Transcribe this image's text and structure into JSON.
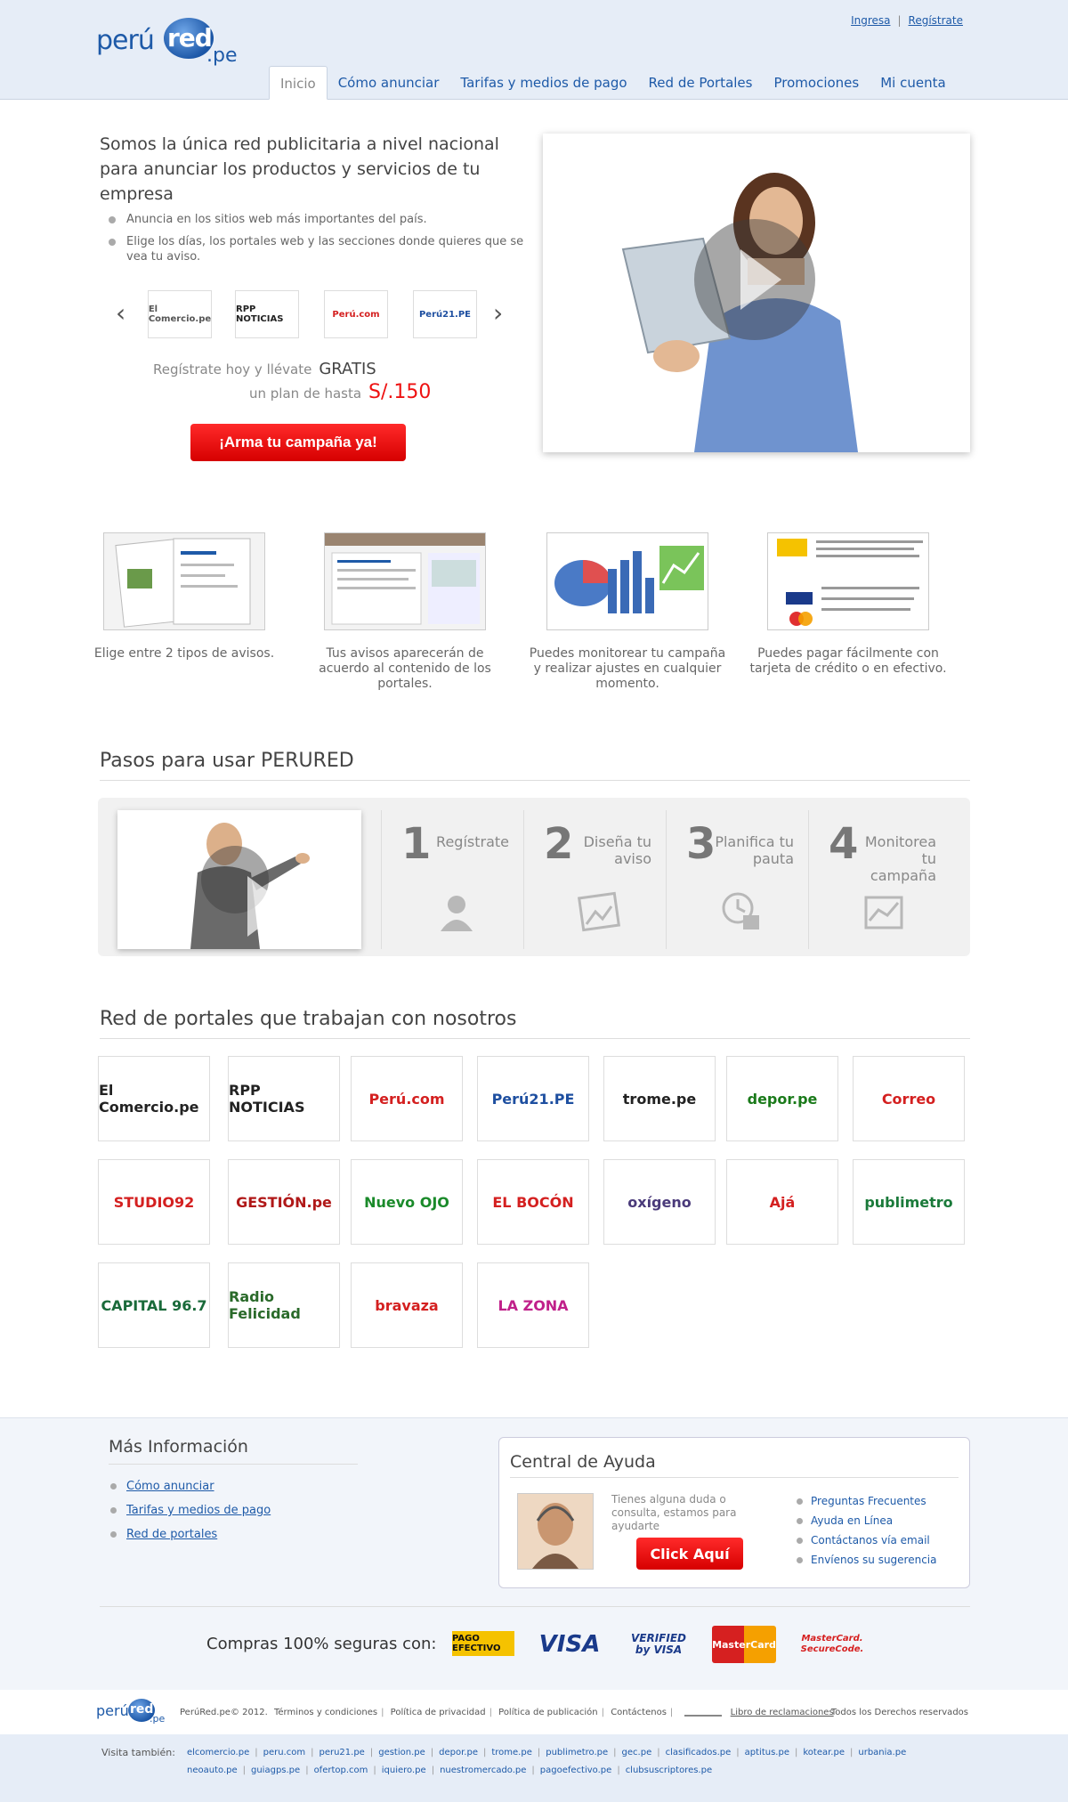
{
  "header": {
    "logo": {
      "part1": "perú",
      "part2": "red",
      "part3": ".pe"
    },
    "top_links": {
      "login": "Ingresa",
      "separator": "|",
      "register": "Regístrate"
    },
    "nav": [
      {
        "label": "Inicio",
        "active": true
      },
      {
        "label": "Cómo anunciar"
      },
      {
        "label": "Tarifas y medios de pago"
      },
      {
        "label": "Red de Portales"
      },
      {
        "label": "Promociones"
      },
      {
        "label": "Mi cuenta"
      }
    ]
  },
  "hero": {
    "title": "Somos la única red publicitaria a nivel nacional para anunciar los productos y servicios de tu empresa",
    "bullets": [
      "Anuncia en los sitios web más importantes del país.",
      "Elige los días, los portales web y las secciones donde quieres que se vea tu aviso."
    ],
    "carousel": {
      "prev": "‹",
      "next": "›",
      "logos": [
        "El Comercio.pe",
        "RPP NOTICIAS",
        "Perú.com",
        "Perú21.PE"
      ]
    },
    "promo_line1": "Regístrate hoy y llévate",
    "promo_highlight1": "GRATIS",
    "promo_line2": "un plan de hasta",
    "promo_highlight2": "S/.150",
    "cta": "¡Arma tu campaña ya!"
  },
  "features": [
    {
      "caption": "Elige entre 2 tipos de avisos."
    },
    {
      "caption": "Tus avisos aparecerán de acuerdo al contenido de los portales."
    },
    {
      "caption": "Puedes monitorear tu campaña y realizar ajustes en cualquier momento."
    },
    {
      "caption": "Puedes pagar fácilmente con tarjeta de crédito o en efectivo."
    }
  ],
  "steps_section": {
    "title": "Pasos para usar PERURED",
    "steps": [
      {
        "number": "1",
        "label": "Regístrate",
        "icon": "user-icon"
      },
      {
        "number": "2",
        "label": "Diseña tu aviso",
        "icon": "image-icon"
      },
      {
        "number": "3",
        "label": "Planifica tu pauta",
        "icon": "calendar-clock-icon"
      },
      {
        "number": "4",
        "label": "Monitorea tu campaña",
        "icon": "chart-icon"
      }
    ]
  },
  "portals_section": {
    "title": "Red de portales que trabajan con nosotros",
    "portals": [
      {
        "name": "El Comercio.pe",
        "color": "#222222"
      },
      {
        "name": "RPP NOTICIAS",
        "color": "#222222"
      },
      {
        "name": "Perú.com",
        "color": "#d42020"
      },
      {
        "name": "Perú21.PE",
        "color": "#1e4fa0"
      },
      {
        "name": "trome.pe",
        "color": "#222222"
      },
      {
        "name": "depor.pe",
        "color": "#1a7a1a"
      },
      {
        "name": "Correo",
        "color": "#d42020"
      },
      {
        "name": "STUDIO92",
        "color": "#d42020"
      },
      {
        "name": "GESTIÓN.pe",
        "color": "#b01818"
      },
      {
        "name": "Nuevo OJO",
        "color": "#1a8a2a"
      },
      {
        "name": "EL BOCÓN",
        "color": "#d42020"
      },
      {
        "name": "oxígeno",
        "color": "#4a3a7a"
      },
      {
        "name": "Ajá",
        "color": "#d42020"
      },
      {
        "name": "publimetro",
        "color": "#1a7a3a"
      },
      {
        "name": "CAPITAL 96.7",
        "color": "#1a6a3a"
      },
      {
        "name": "Radio Felicidad",
        "color": "#2a6a2a"
      },
      {
        "name": "bravaza",
        "color": "#d42020"
      },
      {
        "name": "LA ZONA",
        "color": "#c0208a"
      }
    ]
  },
  "more_info": {
    "title": "Más Información",
    "links": [
      "Cómo anunciar",
      "Tarifas y medios de pago",
      "Red de portales"
    ]
  },
  "help_center": {
    "title": "Central de Ayuda",
    "text": "Tienes alguna duda o consulta, estamos para ayudarte",
    "button": "Click Aquí",
    "links": [
      "Preguntas Frecuentes",
      "Ayuda en Línea",
      "Contáctanos vía email",
      "Envíenos su sugerencia"
    ]
  },
  "payments": {
    "label": "Compras 100% seguras con:",
    "methods": [
      "PAGO EFECTIVO",
      "VISA",
      "VERIFIED by VISA",
      "MasterCard",
      "MasterCard. SecureCode."
    ]
  },
  "footer": {
    "copyright": "PerúRed.pe© 2012.",
    "links": [
      "Términos y condiciones",
      "Política de privacidad",
      "Política de publicación",
      "Contáctenos"
    ],
    "book_link": "Libro de reclamaciones",
    "rights": "Todos los Derechos reservados",
    "visit_label": "Visita también:",
    "visit_row1": [
      "elcomercio.pe",
      "peru.com",
      "peru21.pe",
      "gestion.pe",
      "depor.pe",
      "trome.pe",
      "publimetro.pe",
      "gec.pe",
      "clasificados.pe",
      "aptitus.pe",
      "kotear.pe",
      "urbania.pe"
    ],
    "visit_row2": [
      "neoauto.pe",
      "guiagps.pe",
      "ofertop.com",
      "iquiero.pe",
      "nuestromercado.pe",
      "pagoefectivo.pe",
      "clubsuscriptores.pe"
    ]
  },
  "colors": {
    "accent": "#1e5aa8",
    "cta": "#e00000",
    "band": "#e6edf7"
  }
}
